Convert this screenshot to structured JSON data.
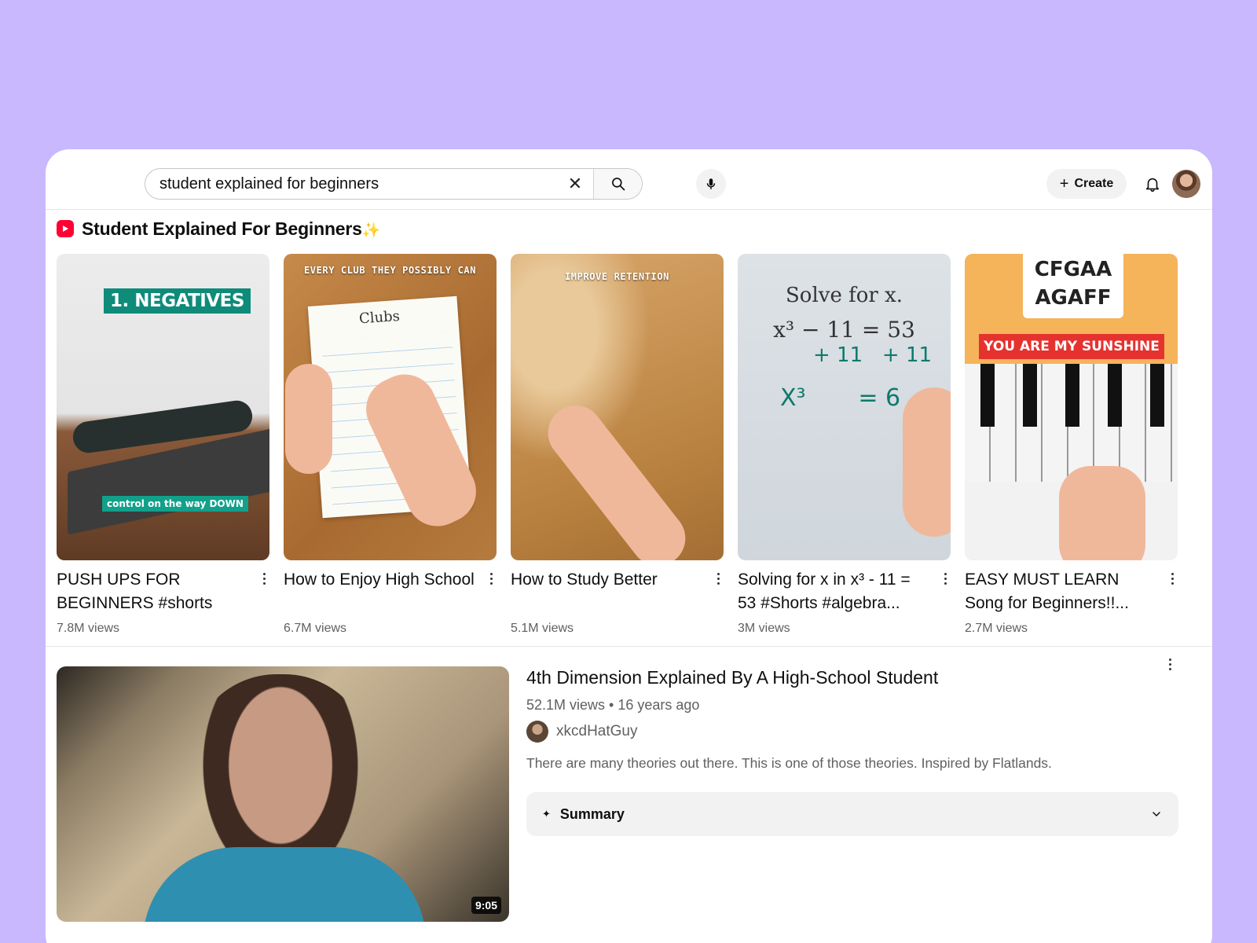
{
  "search": {
    "value": "student explained for beginners",
    "clear_icon": "close-icon",
    "search_icon": "search-icon",
    "mic_icon": "mic-icon"
  },
  "header": {
    "create_label": "Create",
    "bell_icon": "bell-icon"
  },
  "shorts": {
    "section_title": "Student Explained For Beginners",
    "sparkle": "✨",
    "items": [
      {
        "title": "PUSH UPS FOR BEGINNERS #shorts",
        "views": "7.8M views",
        "overlay_main": "1. NEGATIVES",
        "overlay_sub": "control on the way DOWN"
      },
      {
        "title": "How to Enjoy High School",
        "views": "6.7M views",
        "overlay_main": "EVERY CLUB THEY POSSIBLY CAN",
        "paper_title": "Clubs"
      },
      {
        "title": "How to Study Better",
        "views": "5.1M views",
        "overlay_main": "IMPROVE RETENTION"
      },
      {
        "title": "Solving for x in x³ - 11 = 53 #Shorts #algebra...",
        "views": "3M views",
        "board_heading": "Solve for x.",
        "board_equation": "x³ − 11 = 53"
      },
      {
        "title": "EASY MUST LEARN Song for Beginners!!...",
        "views": "2.7M views",
        "card_line1": "CFGAA",
        "card_line2": "AGAFF",
        "banner": "YOU ARE MY SUNSHINE"
      }
    ]
  },
  "main_video": {
    "title": "4th Dimension Explained By A High-School Student",
    "meta": "52.1M views • 16 years ago",
    "channel": "xkcdHatGuy",
    "description": "There are many theories out there. This is one of those theories. Inspired by Flatlands.",
    "duration": "9:05",
    "summary_label": "Summary"
  },
  "colors": {
    "background": "#c9b8fd",
    "brand_red": "#ff0033"
  }
}
